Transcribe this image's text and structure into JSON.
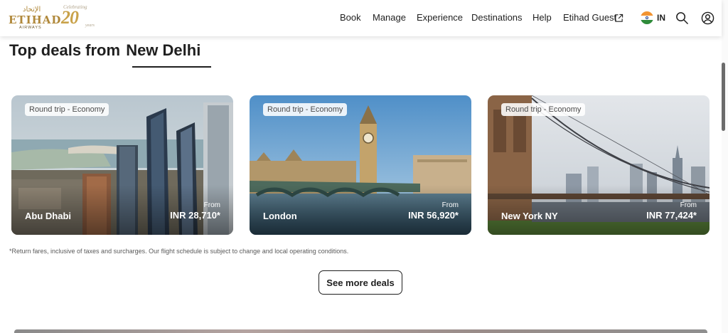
{
  "header": {
    "logo": {
      "arabic": "الإتحاد",
      "name": "ETIHAD",
      "sub": "AIRWAYS"
    },
    "anniversary": {
      "celebrating": "Celebrating",
      "number": "20",
      "years": "years"
    },
    "nav": [
      "Book",
      "Manage",
      "Experience",
      "Destinations",
      "Help",
      "Etihad Guest"
    ],
    "country_code": "IN",
    "icons": [
      "external-link-icon",
      "india-flag-icon",
      "search-icon",
      "user-icon"
    ]
  },
  "section": {
    "title_prefix": "Top deals from",
    "title_city": "New Delhi"
  },
  "deals": [
    {
      "tag": "Round trip - Economy",
      "destination": "Abu Dhabi",
      "from": "From",
      "price": "INR 28,710*"
    },
    {
      "tag": "Round trip - Economy",
      "destination": "London",
      "from": "From",
      "price": "INR 56,920*"
    },
    {
      "tag": "Round trip - Economy",
      "destination": "New York NY",
      "from": "From",
      "price": "INR 77,424*"
    }
  ],
  "disclaimer": "*Return fares, inclusive of taxes and surcharges. Our flight schedule is subject to change and local operating conditions.",
  "see_more_label": "See more deals",
  "colors": {
    "brand_gold": "#b0883a",
    "text": "#1f1f1f"
  }
}
